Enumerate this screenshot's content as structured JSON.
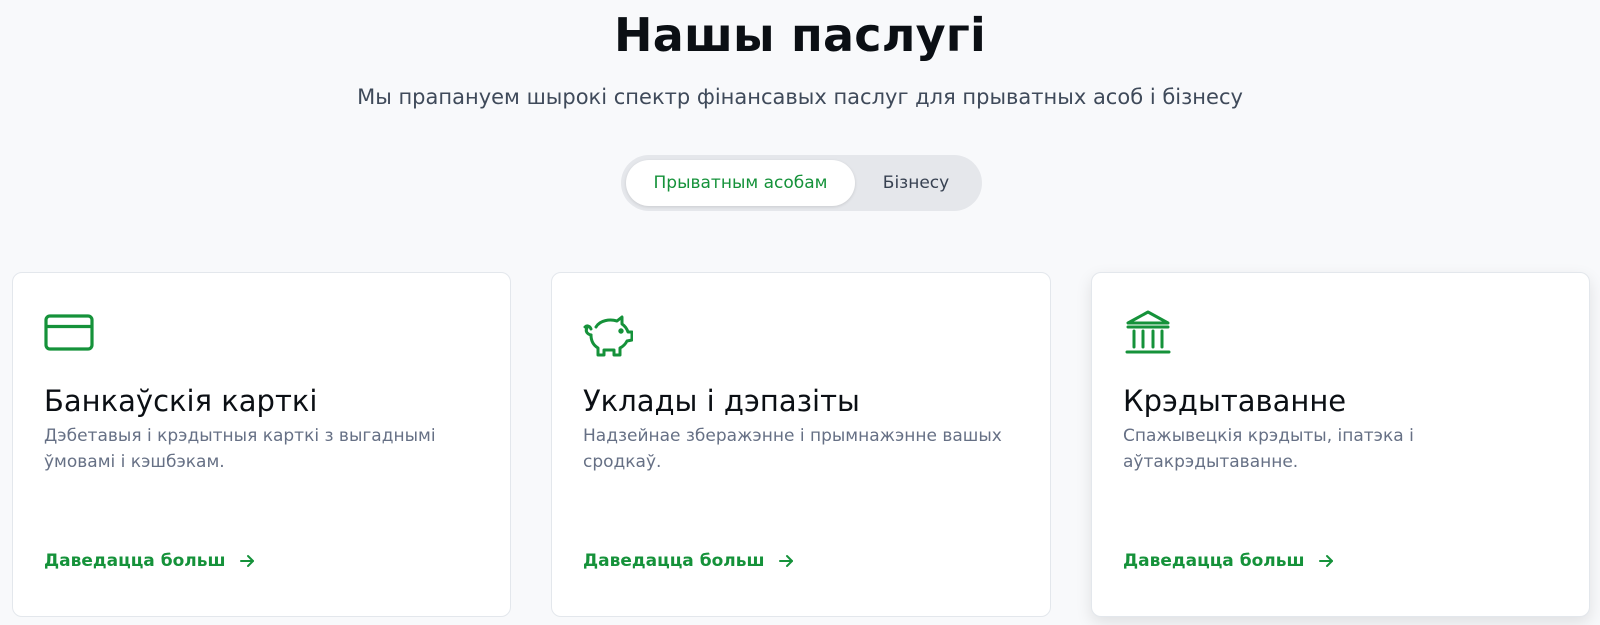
{
  "header": {
    "title": "Нашы паслугі",
    "subtitle": "Мы прапануем шырокі спектр фінансавых паслуг для прыватных асоб і бізнесу"
  },
  "toggle": {
    "options": [
      {
        "label": "Прыватным асобам",
        "active": true
      },
      {
        "label": "Бізнесу",
        "active": false
      }
    ]
  },
  "colors": {
    "accent": "#15923a",
    "background": "#f8f9fb",
    "card": "#ffffff"
  },
  "cards": [
    {
      "icon": "credit-card-icon",
      "title": "Банкаўскія карткі",
      "description": "Дэбетавыя і крэдытныя карткі з выгаднымі ўмовамі і кэшбэкам.",
      "link": "Даведацца больш"
    },
    {
      "icon": "piggy-bank-icon",
      "title": "Уклады і дэпазіты",
      "description": "Надзейнае зберажэнне і прымнажэнне вашых сродкаў.",
      "link": "Даведацца больш"
    },
    {
      "icon": "bank-building-icon",
      "title": "Крэдытаванне",
      "description": "Спажывецкія крэдыты, іпатэка і аўтакрэдытаванне.",
      "link": "Даведацца больш"
    }
  ]
}
